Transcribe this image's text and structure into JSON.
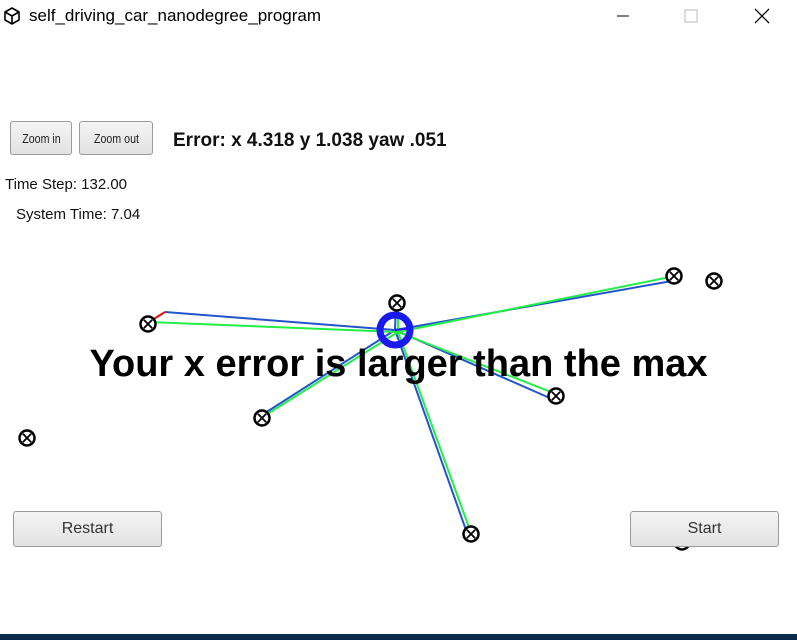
{
  "window": {
    "title": "self_driving_car_nanodegree_program"
  },
  "toolbar": {
    "zoom_in_label": "Zoom in",
    "zoom_out_label": "Zoom out"
  },
  "status": {
    "error": "Error: x 4.318 y 1.038 yaw .051",
    "time_step": "Time Step: 132.00",
    "system_time": "System Time: 7.04"
  },
  "message": "Your x error is larger than the max",
  "buttons": {
    "restart_label": "Restart",
    "start_label": "Start"
  },
  "colors": {
    "vehicle": "#1a1aee",
    "observation_line": "#2255cc",
    "prediction_line": "#22ee44",
    "landmark": "#000000",
    "short_segment": "#dd1111"
  }
}
